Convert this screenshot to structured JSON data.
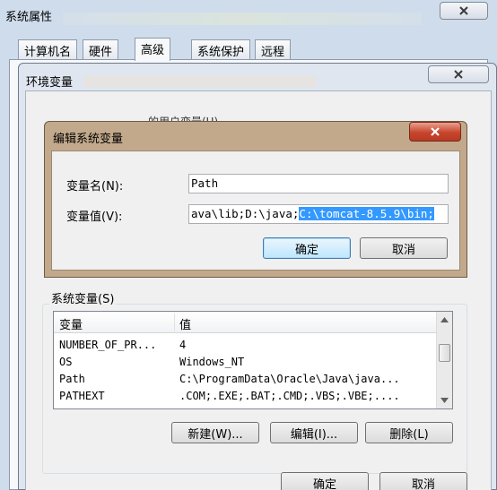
{
  "sysprop": {
    "title": "系统属性",
    "tabs": [
      "计算机名",
      "硬件",
      "高级",
      "系统保护",
      "远程"
    ]
  },
  "envvars": {
    "title": "环境变量",
    "user_group_label": "的用户变量(U)",
    "sys_group_label": "系统变量(S)",
    "sys_table": {
      "headers": [
        "变量",
        "值"
      ],
      "rows": [
        {
          "name": "NUMBER_OF_PR...",
          "value": "4"
        },
        {
          "name": "OS",
          "value": "Windows_NT"
        },
        {
          "name": "Path",
          "value": "C:\\ProgramData\\Oracle\\Java\\java..."
        },
        {
          "name": "PATHEXT",
          "value": ".COM;.EXE;.BAT;.CMD;.VBS;.VBE;...."
        }
      ]
    },
    "buttons": {
      "new": "新建(W)...",
      "edit": "编辑(I)...",
      "delete": "删除(L)",
      "ok": "确定",
      "cancel": "取消"
    }
  },
  "edit_dialog": {
    "title": "编辑系统变量",
    "name_label": "变量名(N):",
    "name_value": "Path",
    "value_label": "变量值(V):",
    "value_prefix": "ava\\lib;D:\\java;",
    "value_selected": "C:\\tomcat-8.5.9\\bin;",
    "ok_label": "确定",
    "cancel_label": "取消"
  },
  "colors": {
    "selection": "#3399ff",
    "dialog_frame": "#c2a98c",
    "env_frame": "#dfe6ef",
    "close_red": "#c7452d"
  }
}
